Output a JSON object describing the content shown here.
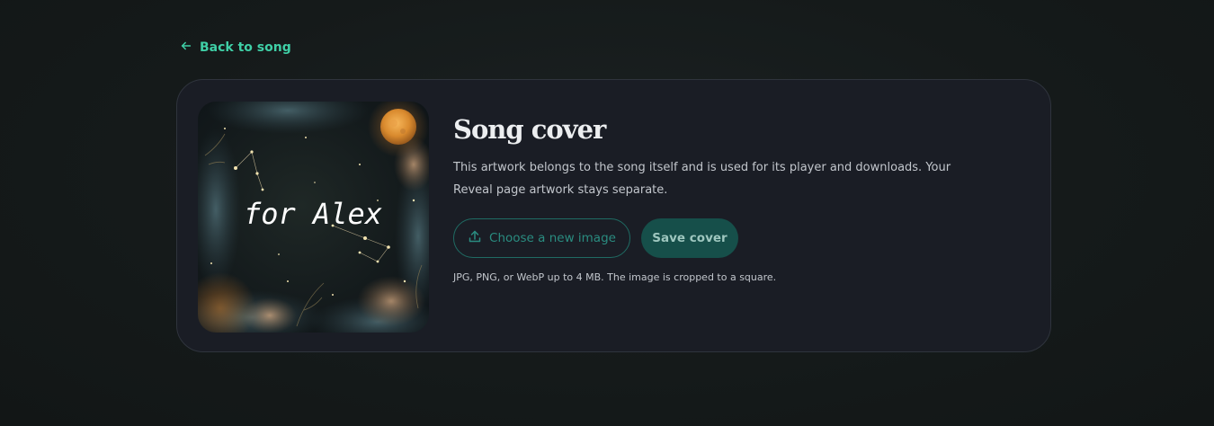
{
  "nav": {
    "back_label": "Back to song"
  },
  "card": {
    "title": "Song cover",
    "description": "This artwork belongs to the song itself and is used for its player and downloads. Your Reveal page artwork stays separate.",
    "choose_label": "Choose a new image",
    "save_label": "Save cover",
    "hint": "JPG, PNG, or WebP up to 4 MB. The image is cropped to a square."
  },
  "cover_art": {
    "text": "for Alex"
  },
  "icons": {
    "back": "arrow-left-icon",
    "upload": "upload-icon"
  },
  "colors": {
    "accent": "#3fcfa6",
    "button_fill": "#164f4a",
    "card_bg": "#1a1d25"
  }
}
